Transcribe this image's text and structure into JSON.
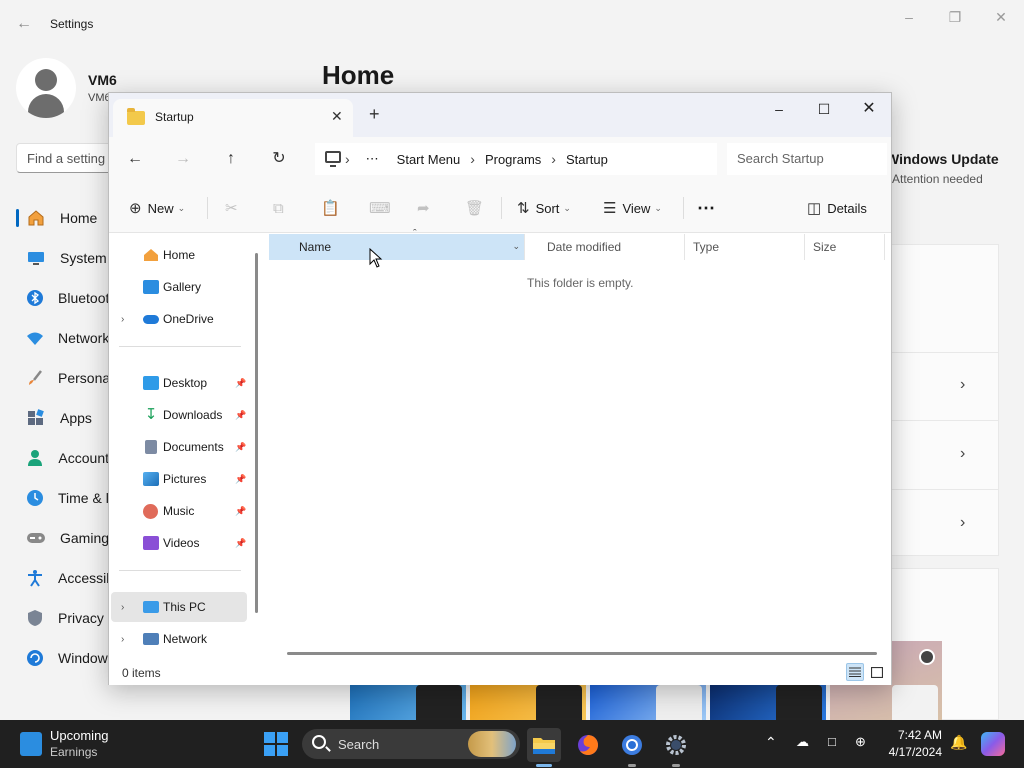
{
  "settings": {
    "window_title": "Settings",
    "user_name": "VM6",
    "user_sub": "VM6",
    "search_placeholder": "Find a setting",
    "page_heading": "Home",
    "nav": [
      {
        "label": "Home",
        "icon": "home-icon"
      },
      {
        "label": "System",
        "icon": "monitor-icon"
      },
      {
        "label": "Bluetooth & devices",
        "icon": "bluetooth-icon"
      },
      {
        "label": "Network & internet",
        "icon": "wifi-icon"
      },
      {
        "label": "Personalization",
        "icon": "brush-icon"
      },
      {
        "label": "Apps",
        "icon": "apps-icon"
      },
      {
        "label": "Accounts",
        "icon": "person-icon"
      },
      {
        "label": "Time & language",
        "icon": "clock-globe-icon"
      },
      {
        "label": "Gaming",
        "icon": "gamepad-icon"
      },
      {
        "label": "Accessibility",
        "icon": "accessibility-icon"
      },
      {
        "label": "Privacy & security",
        "icon": "shield-icon"
      },
      {
        "label": "Windows Update",
        "icon": "update-icon"
      }
    ],
    "windows_update": {
      "title": "Windows Update",
      "status": "Attention needed"
    }
  },
  "explorer": {
    "tab_title": "Startup",
    "breadcrumbs": [
      "Start Menu",
      "Programs",
      "Startup"
    ],
    "search_placeholder": "Search Startup",
    "commands": {
      "new": "New",
      "sort": "Sort",
      "view": "View",
      "details": "Details"
    },
    "nav_items": [
      {
        "label": "Home",
        "icon": "home-icon"
      },
      {
        "label": "Gallery",
        "icon": "gallery-icon"
      },
      {
        "label": "OneDrive",
        "icon": "onedrive-icon",
        "expandable": true
      },
      {
        "label": "Desktop",
        "icon": "desktop-icon",
        "pinned": true
      },
      {
        "label": "Downloads",
        "icon": "download-icon",
        "pinned": true
      },
      {
        "label": "Documents",
        "icon": "documents-icon",
        "pinned": true
      },
      {
        "label": "Pictures",
        "icon": "pictures-icon",
        "pinned": true
      },
      {
        "label": "Music",
        "icon": "music-icon",
        "pinned": true
      },
      {
        "label": "Videos",
        "icon": "videos-icon",
        "pinned": true
      },
      {
        "label": "This PC",
        "icon": "this-pc-icon",
        "expandable": true,
        "selected": true
      },
      {
        "label": "Network",
        "icon": "network-icon",
        "expandable": true
      }
    ],
    "columns": [
      "Name",
      "Date modified",
      "Type",
      "Size"
    ],
    "empty_message": "This folder is empty.",
    "status": "0 items"
  },
  "taskbar": {
    "widget_title": "Upcoming",
    "widget_sub": "Earnings",
    "search_label": "Search",
    "time": "7:42 AM",
    "date": "4/17/2024",
    "apps": [
      "file-explorer-icon",
      "firefox-icon",
      "chrome-icon",
      "settings-icon"
    ],
    "accent": "#3aa0f5"
  }
}
